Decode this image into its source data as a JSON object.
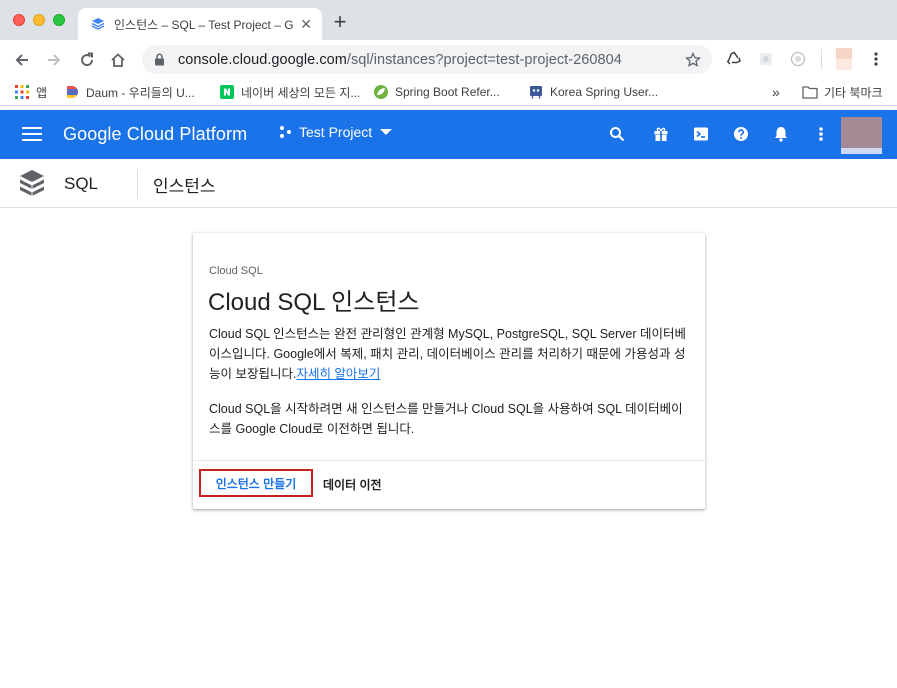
{
  "browser": {
    "tab_title": "인스턴스 – SQL – Test Project – G",
    "new_tab": "+",
    "url_host": "console.cloud.google.com",
    "url_path": "/sql/instances?project=test-project-260804"
  },
  "bookmarks": {
    "items": [
      {
        "label": "앱"
      },
      {
        "label": "Daum - 우리들의 U..."
      },
      {
        "label": "네이버 세상의 모든 지..."
      },
      {
        "label": "Spring Boot Refer..."
      },
      {
        "label": "Korea Spring User..."
      }
    ],
    "overflow": "»",
    "other": "기타 북마크"
  },
  "gcp": {
    "logo": "Google Cloud Platform",
    "project": "Test Project",
    "brand_color": "#1a73e8"
  },
  "subheader": {
    "product": "SQL",
    "page_title": "인스턴스"
  },
  "card": {
    "kicker": "Cloud SQL",
    "title": "Cloud SQL 인스턴스",
    "p1": "Cloud SQL 인스턴스는 완전 관리형인 관계형 MySQL, PostgreSQL, SQL Server 데이터베이스입니다. Google에서 복제, 패치 관리, 데이터베이스 관리를 처리하기 때문에 가용성과 성능이 보장됩니다.",
    "p1_link": "자세히 알아보기",
    "p2": "Cloud SQL을 시작하려면 새 인스턴스를 만들거나 Cloud SQL을 사용하여 SQL 데이터베이스를 Google Cloud로 이전하면 됩니다.",
    "create_button": "인스턴스 만들기",
    "migrate_button": "데이터 이전"
  }
}
